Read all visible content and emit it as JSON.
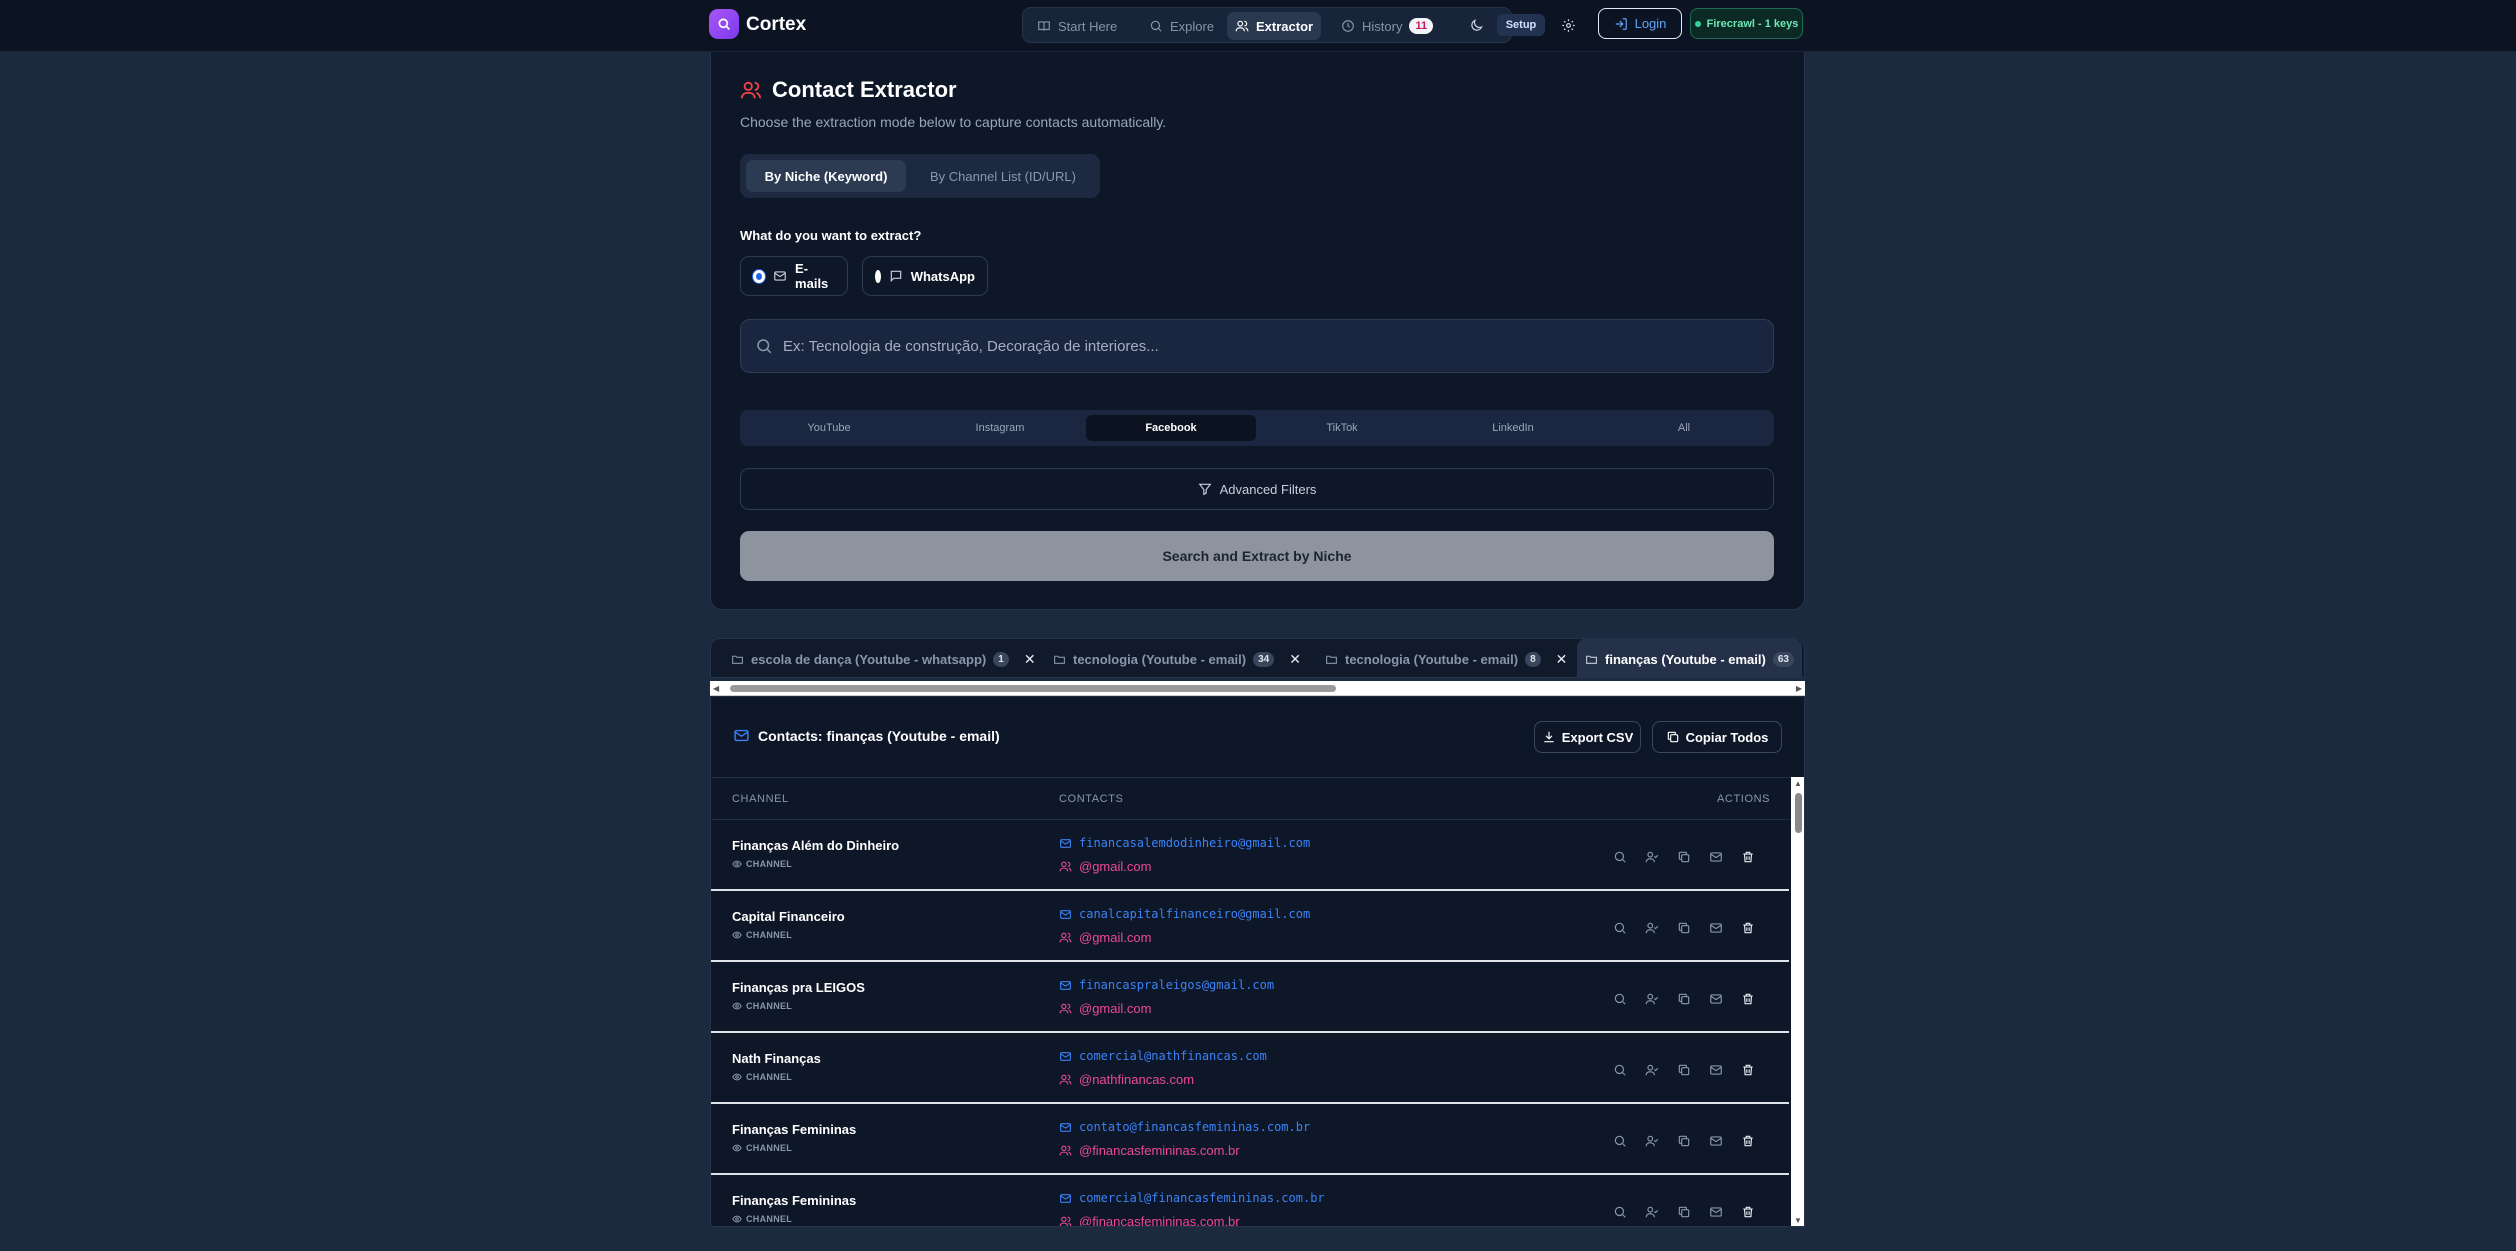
{
  "app": {
    "brand": "Cortex",
    "accent": "#8b5cf6"
  },
  "nav": {
    "items": [
      {
        "label": "Start Here",
        "icon": "book-icon"
      },
      {
        "label": "Explore",
        "icon": "search-icon"
      },
      {
        "label": "Extractor",
        "icon": "users-icon",
        "active": true
      },
      {
        "label": "History",
        "icon": "clock-icon",
        "badge": "11"
      }
    ],
    "setup_label": "Setup",
    "login_label": "Login",
    "firecrawl_label": "Firecrawl - 1 keys"
  },
  "extractor": {
    "title": "Contact Extractor",
    "subtitle": "Choose the extraction mode below to capture contacts automatically.",
    "modes": [
      "By Niche (Keyword)",
      "By Channel List (ID/URL)"
    ],
    "active_mode": "By Niche (Keyword)",
    "question": "What do you want to extract?",
    "options": [
      {
        "label": "E-mails",
        "selected": true
      },
      {
        "label": "WhatsApp",
        "selected": false
      }
    ],
    "search_placeholder": "Ex: Tecnologia de construção, Decoração de interiores...",
    "search_value": "",
    "platforms": [
      "YouTube",
      "Instagram",
      "Facebook",
      "TikTok",
      "LinkedIn",
      "All"
    ],
    "active_platform": "Facebook",
    "advanced_label": "Advanced Filters",
    "submit_label": "Search and Extract by Niche"
  },
  "tabs": [
    {
      "label": "escola de dança (Youtube - whatsapp)",
      "count": "1"
    },
    {
      "label": "tecnologia (Youtube - email)",
      "count": "34"
    },
    {
      "label": "tecnologia (Youtube - email)",
      "count": "8"
    },
    {
      "label": "finanças (Youtube - email)",
      "count": "63",
      "active": true
    }
  ],
  "contacts": {
    "title": "Contacts: finanças (Youtube - email)",
    "export_label": "Export CSV",
    "copy_label": "Copiar Todos",
    "columns": [
      "CHANNEL",
      "CONTACTS",
      "ACTIONS"
    ],
    "rows": [
      {
        "name": "Finanças Além do Dinheiro",
        "type": "CHANNEL",
        "email": "financasalemdodinheiro@gmail.com",
        "handle": "@gmail.com"
      },
      {
        "name": "Capital Financeiro",
        "type": "CHANNEL",
        "email": "canalcapitalfinanceiro@gmail.com",
        "handle": "@gmail.com"
      },
      {
        "name": "Finanças pra LEIGOS",
        "type": "CHANNEL",
        "email": "financaspraleigos@gmail.com",
        "handle": "@gmail.com"
      },
      {
        "name": "Nath Finanças",
        "type": "CHANNEL",
        "email": "comercial@nathfinancas.com",
        "handle": "@nathfinancas.com"
      },
      {
        "name": "Finanças Femininas",
        "type": "CHANNEL",
        "email": "contato@financasfemininas.com.br",
        "handle": "@financasfemininas.com.br"
      },
      {
        "name": "Finanças Femininas",
        "type": "CHANNEL",
        "email": "comercial@financasfemininas.com.br",
        "handle": "@financasfemininas.com.br"
      }
    ]
  }
}
